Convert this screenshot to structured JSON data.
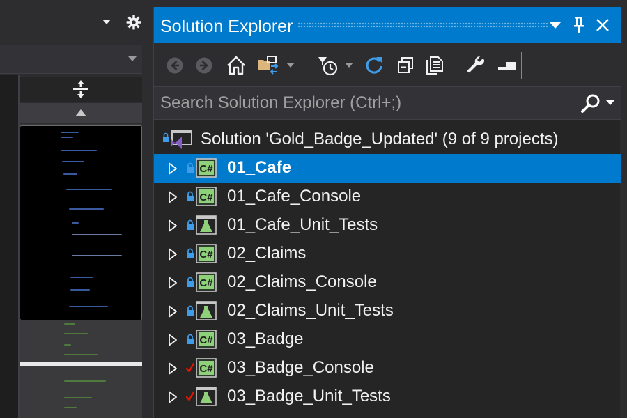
{
  "solution_explorer": {
    "title": "Solution Explorer",
    "search": {
      "placeholder": "Search Solution Explorer (Ctrl+;)",
      "value": ""
    },
    "solution_label": "Solution 'Gold_Badge_Updated' (9 of 9 projects)",
    "projects": [
      {
        "name": "01_Cafe",
        "kind": "csharp",
        "status": "lock",
        "selected": true
      },
      {
        "name": "01_Cafe_Console",
        "kind": "csharp",
        "status": "lock",
        "selected": false
      },
      {
        "name": "01_Cafe_Unit_Tests",
        "kind": "test",
        "status": "lock",
        "selected": false
      },
      {
        "name": "02_Claims",
        "kind": "csharp",
        "status": "lock",
        "selected": false
      },
      {
        "name": "02_Claims_Console",
        "kind": "csharp",
        "status": "lock",
        "selected": false
      },
      {
        "name": "02_Claims_Unit_Tests",
        "kind": "test",
        "status": "lock",
        "selected": false
      },
      {
        "name": "03_Badge",
        "kind": "csharp",
        "status": "lock",
        "selected": false
      },
      {
        "name": "03_Badge_Console",
        "kind": "csharp",
        "status": "checked-out",
        "selected": false
      },
      {
        "name": "03_Badge_Unit_Tests",
        "kind": "test",
        "status": "checked-out",
        "selected": false
      }
    ],
    "project_icon_text": "C#",
    "toolbar_icons": [
      "back-icon",
      "forward-icon",
      "home-icon",
      "switch-views-icon",
      "pending-changes-filter-icon",
      "refresh-icon",
      "collapse-all-icon",
      "show-all-files-icon",
      "properties-icon",
      "preview-selected-items-icon"
    ],
    "title_icons": [
      "window-position-icon",
      "pin-icon",
      "close-icon"
    ]
  },
  "colors": {
    "accent": "#007acc",
    "panel_bg": "#252526",
    "toolbar_bg": "#2d2d30",
    "text": "#f1f1f1",
    "csharp_green": "#8fd17a",
    "lock_blue": "#3e9ce8",
    "check_red": "#e51400"
  }
}
